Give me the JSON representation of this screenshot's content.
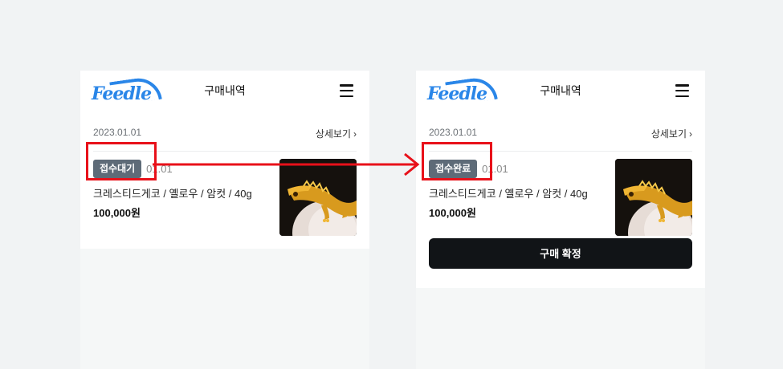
{
  "left_screen": {
    "logo_text": "Feedle",
    "page_title": "구매내역",
    "order_date": "2023.01.01",
    "detail_link": "상세보기",
    "status": "접수대기",
    "item_date": "01.01",
    "product_name": "크레스티드게코 / 옐로우 / 암컷 / 40g",
    "price": "100,000원"
  },
  "right_screen": {
    "logo_text": "Feedle",
    "page_title": "구매내역",
    "order_date": "2023.01.01",
    "detail_link": "상세보기",
    "status": "접수완료",
    "item_date": "01.01",
    "product_name": "크레스티드게코 / 옐로우 / 암컷 / 40g",
    "price": "100,000원",
    "confirm_button": "구매 확정"
  },
  "icons": {
    "menu": "hamburger-menu-icon",
    "chevron": "chevron-right-icon",
    "product_image": "crested-gecko-photo"
  },
  "colors": {
    "brand": "#2a86e8",
    "status_badge": "#5e6b78",
    "annotation": "#e8111a",
    "confirm_button": "#111417"
  }
}
